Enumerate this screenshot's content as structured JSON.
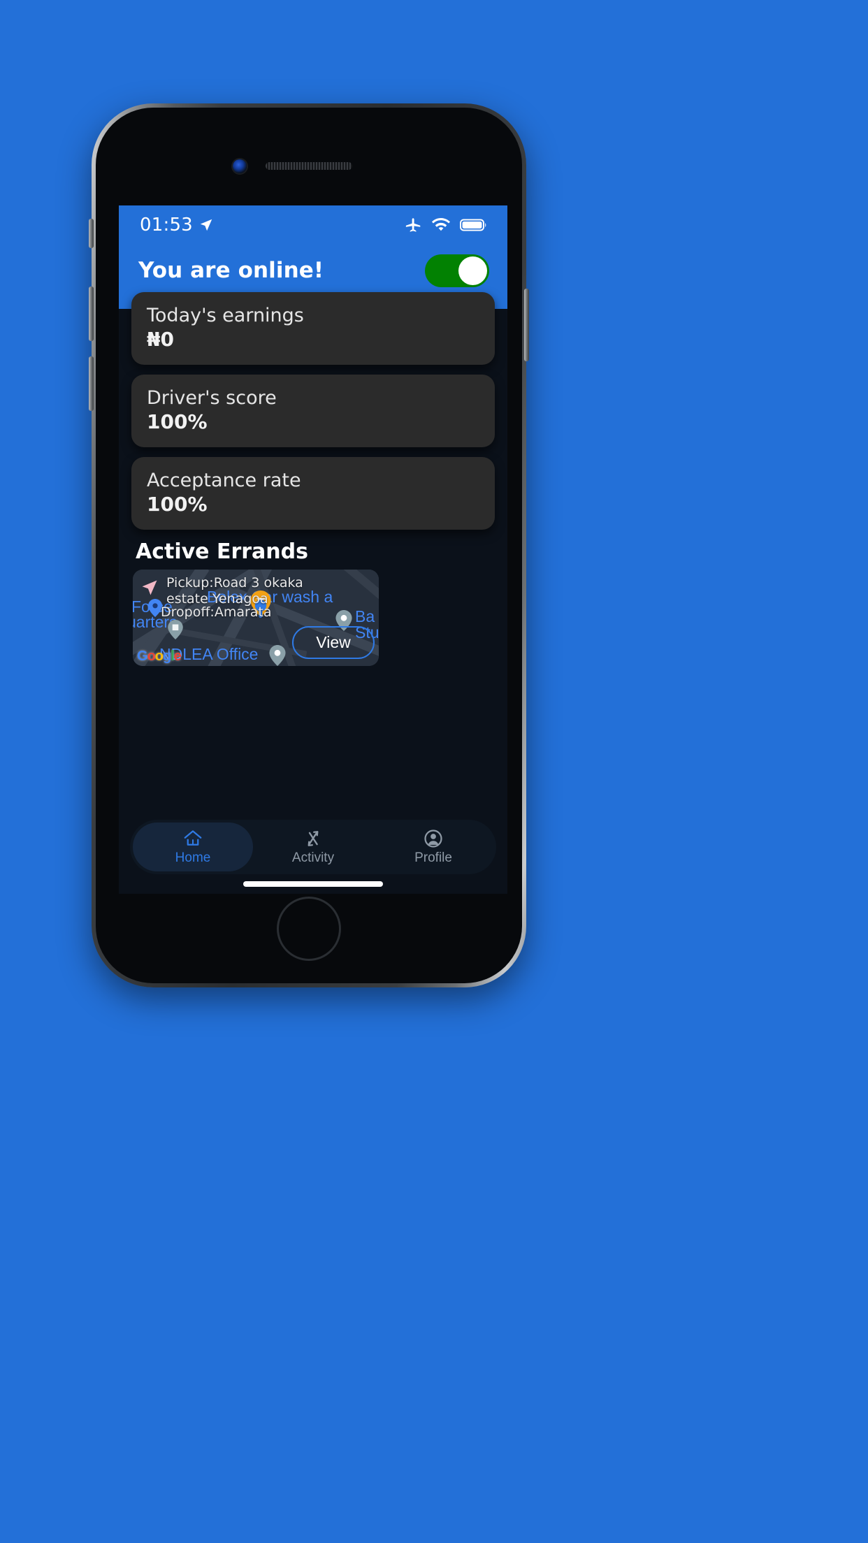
{
  "statusbar": {
    "time": "01:53",
    "icons": [
      "location-arrow-icon",
      "airplane-mode-icon",
      "wifi-icon",
      "battery-full-icon"
    ]
  },
  "header": {
    "online_text": "You are online!",
    "toggle_state": "on",
    "toggle_color": "#028102",
    "background_color": "#2370D8"
  },
  "stats": [
    {
      "label": "Today's earnings",
      "value": "₦0"
    },
    {
      "label": "Driver's score",
      "value": "100%"
    },
    {
      "label": "Acceptance rate",
      "value": "100%"
    }
  ],
  "active_errands": {
    "title": "Active Errands",
    "card": {
      "pickup": "Pickup:Road 3 okaka estate Yenagoa",
      "dropoff": "Dropoff:Amarata",
      "view_label": "View",
      "map_labels": [
        "Bolex Car wash a",
        "Force",
        "uarters",
        "Ba",
        "Stu",
        "NDLEA Office"
      ],
      "map_attribution": "Google"
    }
  },
  "bottom_nav": {
    "items": [
      {
        "label": "Home",
        "icon": "home-icon",
        "active": true
      },
      {
        "label": "Activity",
        "icon": "transfer-arrows-icon",
        "active": false
      },
      {
        "label": "Profile",
        "icon": "person-circle-icon",
        "active": false
      }
    ],
    "active_color": "#2f7ae5",
    "inactive_color": "#8f9aa6"
  }
}
